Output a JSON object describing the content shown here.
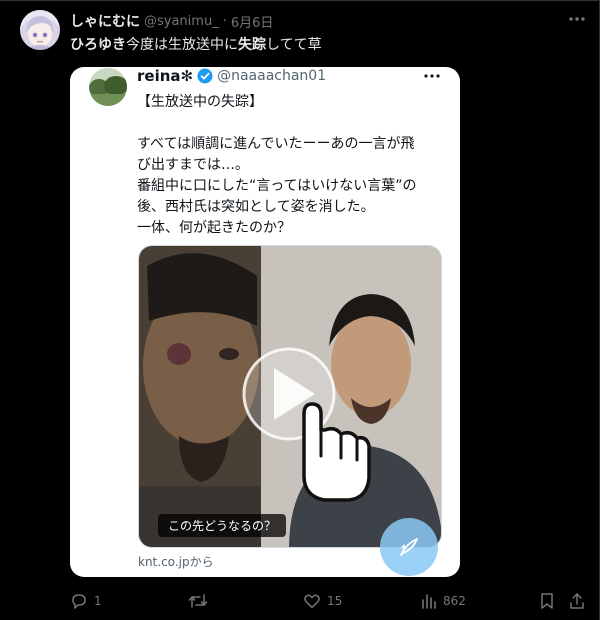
{
  "tweet": {
    "display_name": "しゃにむに",
    "handle": "@syanimu_",
    "separator": "·",
    "date": "6月6日",
    "text_parts": [
      "ひろゆき",
      "今度は生放送中に",
      "失踪",
      "してて草"
    ]
  },
  "quoted": {
    "display_name": "reina✻",
    "handle": "@naaaachan01",
    "verified": true,
    "body_lines": [
      "【生放送中の失踪】",
      "",
      "すべては順調に進んでいたーーあの一言が飛",
      "び出すまでは…。",
      "番組中に口にした“言ってはいけない言葉”の",
      "後、西村氏は突如として姿を消した。",
      "一体、何が起きたのか？"
    ],
    "media_caption": "この先どうなるの？",
    "source": "knt.co.jpから"
  },
  "actions": {
    "replies": "1",
    "reposts": "",
    "likes": "15",
    "views": "862"
  },
  "colors": {
    "background": "#000000",
    "text_primary": "#e7e9ea",
    "text_secondary": "#71767b",
    "verified_blue": "#1d9bf0",
    "fab": "#89c8f5"
  },
  "icons": [
    "more-icon",
    "verified-icon",
    "play-icon",
    "pointer-hand-icon",
    "compose-icon",
    "reply-icon",
    "repost-icon",
    "like-icon",
    "views-icon",
    "bookmark-icon",
    "share-icon"
  ]
}
